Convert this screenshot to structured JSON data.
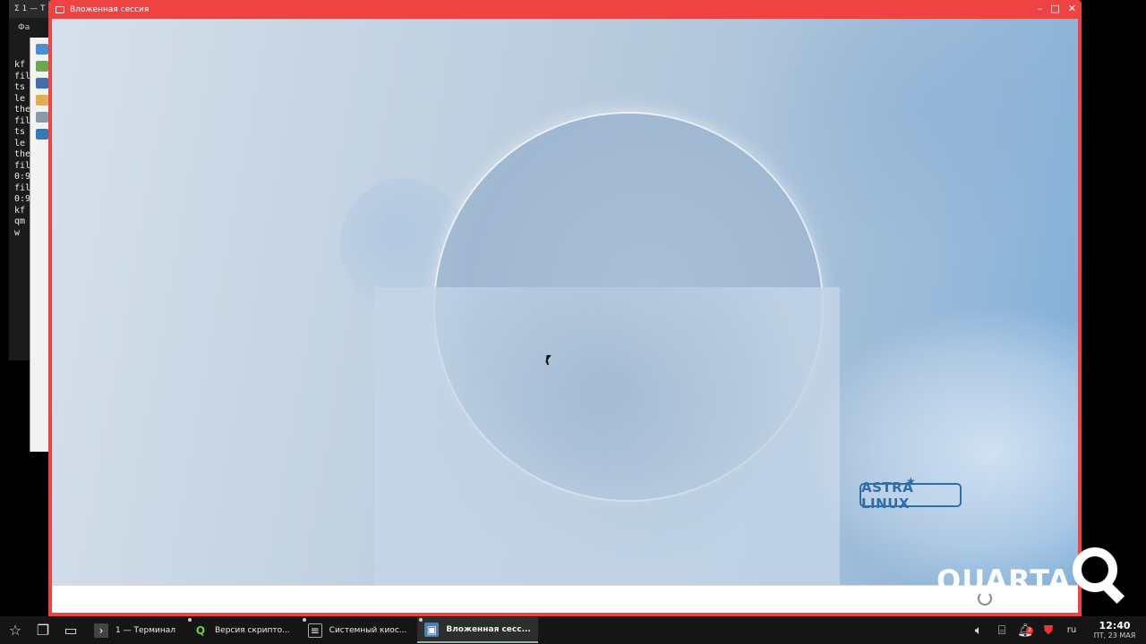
{
  "background_terminal": {
    "title": "1 — Т",
    "menu": "Фа",
    "lines": [
      "kf",
      "fil",
      "ts",
      "le",
      "the",
      "fil",
      "ts",
      "le",
      "the",
      "fil",
      "0:9",
      "fil",
      "0:9",
      "kf",
      "qm",
      "w"
    ]
  },
  "session_window": {
    "title": "Вложенная сессия",
    "logo_text": "ASTRA LINUX"
  },
  "watermark": {
    "text": "QUARTA"
  },
  "taskbar": {
    "tasks": [
      {
        "label": "1 — Терминал",
        "icon": "terminal-icon"
      },
      {
        "label": "Версия скрипто...",
        "icon": "qgis-icon"
      },
      {
        "label": "Системный киос...",
        "icon": "kiosk-icon"
      },
      {
        "label": "Вложенная сесс...",
        "icon": "nested-session-icon"
      }
    ],
    "tray": {
      "notification_count": "2",
      "language": "ru",
      "time": "12:40",
      "date": "ПТ, 23 МАЯ"
    }
  },
  "colors": {
    "session_frame": "#ed4343",
    "logo": "#2f6ea8",
    "taskbar": "#151515"
  }
}
